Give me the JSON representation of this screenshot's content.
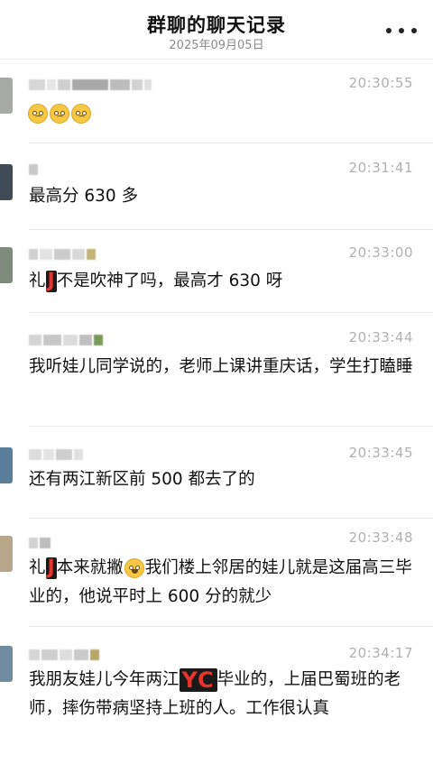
{
  "header": {
    "title": "群聊的聊天记录",
    "date": "2025年09月05日"
  },
  "messages": [
    {
      "time": "20:30:55",
      "text_parts": [],
      "emoji_count": 3,
      "avatar_color": "#9aa39e"
    },
    {
      "time": "20:31:41",
      "text_parts": [
        "最高分 630 多"
      ],
      "avatar_color": "#3c4a55"
    },
    {
      "time": "20:33:00",
      "text_parts": [
        "礼",
        "J",
        "不是吹神了吗，最高才 630 呀"
      ],
      "avatar_color": "#7b8a7a"
    },
    {
      "time": "20:33:44",
      "text_parts": [
        "我听娃儿同学说的，老师上课讲重庆话，学生打瞌睡"
      ],
      "avatar_color": "#ffffff"
    },
    {
      "time": "20:33:45",
      "text_parts": [
        "还有两江新区前 500 都去了的"
      ],
      "avatar_color": "#5a7d9a"
    },
    {
      "time": "20:33:48",
      "text_parts": [
        "礼",
        "J",
        "本来就撇",
        "我们楼上邻居的娃儿就是这届高三毕业的，他说平时上 600 分的就少"
      ],
      "avatar_color": "#b9a58a"
    },
    {
      "time": "20:34:17",
      "text_parts": [
        "我朋友娃儿今年两江",
        "YC",
        "毕业的，上届巴蜀班的老师，摔伤带病坚持上班的人。工作很认真"
      ],
      "avatar_color": "#6e8a9e"
    }
  ],
  "colors": {
    "accent_red": "#e8332a",
    "time_gray": "#b0b0b0",
    "divider": "#ececec"
  },
  "icons": {
    "more": "more-dots-icon",
    "emoji": "smiley-emoji-icon",
    "laugh": "laughing-emoji-icon"
  }
}
